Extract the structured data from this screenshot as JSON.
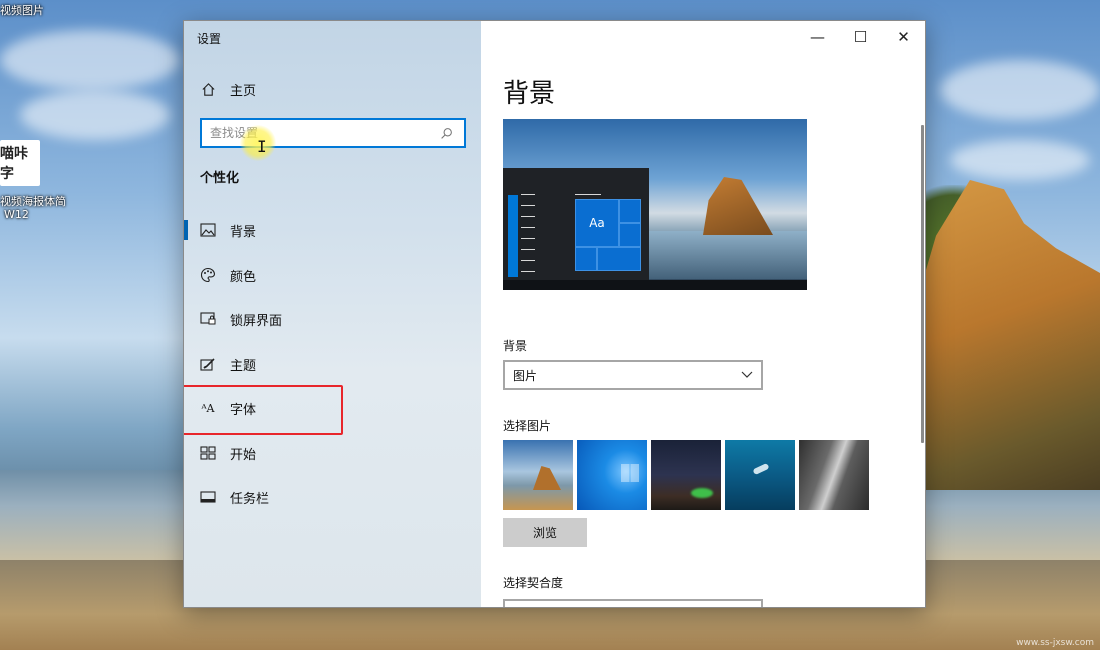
{
  "desktop": {
    "top_label": "视频图片",
    "file_icon_text": "喵咔字",
    "file_label_line1": "视频海报体简",
    "file_label_line2": "W12",
    "watermark": "www.ss-jxsw.com"
  },
  "window": {
    "title": "设置",
    "controls": {
      "minimize": "—",
      "maximize": "☐",
      "close": "✕"
    }
  },
  "sidebar": {
    "home": "主页",
    "search_placeholder": "查找设置",
    "section": "个性化",
    "items": [
      {
        "label": "背景",
        "icon": "picture-icon",
        "active": true
      },
      {
        "label": "颜色",
        "icon": "palette-icon",
        "active": false
      },
      {
        "label": "锁屏界面",
        "icon": "lockscreen-icon",
        "active": false
      },
      {
        "label": "主题",
        "icon": "theme-brush-icon",
        "active": false
      },
      {
        "label": "字体",
        "icon": "font-icon",
        "active": false,
        "highlighted": true
      },
      {
        "label": "开始",
        "icon": "start-tiles-icon",
        "active": false
      },
      {
        "label": "任务栏",
        "icon": "taskbar-icon",
        "active": false
      }
    ]
  },
  "content": {
    "title": "背景",
    "preview_tile_text": "Aa",
    "background_label": "背景",
    "background_value": "图片",
    "choose_picture_label": "选择图片",
    "browse_button": "浏览",
    "fit_label": "选择契合度"
  },
  "colors": {
    "accent": "#0078d7",
    "highlight_frame": "#e8262b",
    "sidebar_bg": "#d2e0ec"
  }
}
